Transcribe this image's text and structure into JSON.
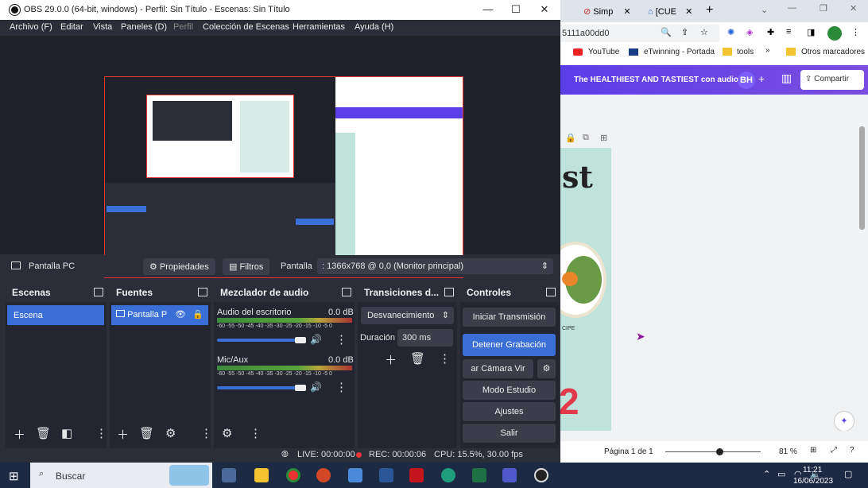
{
  "obs": {
    "title": "OBS 29.0.0 (64-bit, windows) - Perfil: Sin Título - Escenas: Sin Título",
    "menu": [
      "Archivo (F)",
      "Editar",
      "Vista",
      "Paneles (D)",
      "Perfil",
      "Colección de Escenas",
      "Herramientas",
      "Ayuda (H)"
    ],
    "source_bar": {
      "name": "Pantalla PC",
      "properties": "Propiedades",
      "filters": "Filtros",
      "display_label": "Pantalla",
      "display_value": ": 1366x768 @ 0,0 (Monitor principal)"
    },
    "docks": {
      "scenes": "Escenas",
      "sources": "Fuentes",
      "mixer": "Mezclador de audio",
      "transitions": "Transiciones d...",
      "controls": "Controles"
    },
    "scene_item": "Escena",
    "source_item": "Pantalla P",
    "mixer": [
      {
        "name": "Audio del escritorio",
        "db": "0.0 dB",
        "level": 0.0
      },
      {
        "name": "Mic/Aux",
        "db": "0.0 dB",
        "level": 0.0
      }
    ],
    "meter_ticks": [
      "-60",
      "-55",
      "-50",
      "-45",
      "-40",
      "-35",
      "-30",
      "-25",
      "-20",
      "-15",
      "-10",
      "-5",
      "0"
    ],
    "transition": "Desvanecimiento",
    "duration_label": "Duración",
    "duration_value": "300 ms",
    "controls": [
      "Iniciar Transmisión",
      "Detener Grabación",
      "ar Cámara Vir",
      "Modo Estudio",
      "Ajustes",
      "Salir"
    ],
    "status": {
      "live": "LIVE: 00:00:00",
      "rec": "REC: 00:00:06",
      "cpu": "CPU: 15.5%, 30.00 fps"
    }
  },
  "chrome": {
    "tabs": [
      "Simp",
      "[CUE"
    ],
    "url": "5111a00dd0",
    "bookmarks": [
      "YouTube",
      "eTwinning - Portada",
      "tools",
      "Otros marcadores"
    ],
    "canva_title": "The HEALTHIEST AND TASTIEST con audios",
    "avatar": "BH",
    "share": "Compartir",
    "page_text": "st",
    "page_number": "2",
    "recipe": "CIPE",
    "pager": "Página 1 de 1",
    "zoom": "81 %"
  },
  "taskbar": {
    "search": "Buscar",
    "time": "11:21",
    "date": "16/06/2023"
  }
}
